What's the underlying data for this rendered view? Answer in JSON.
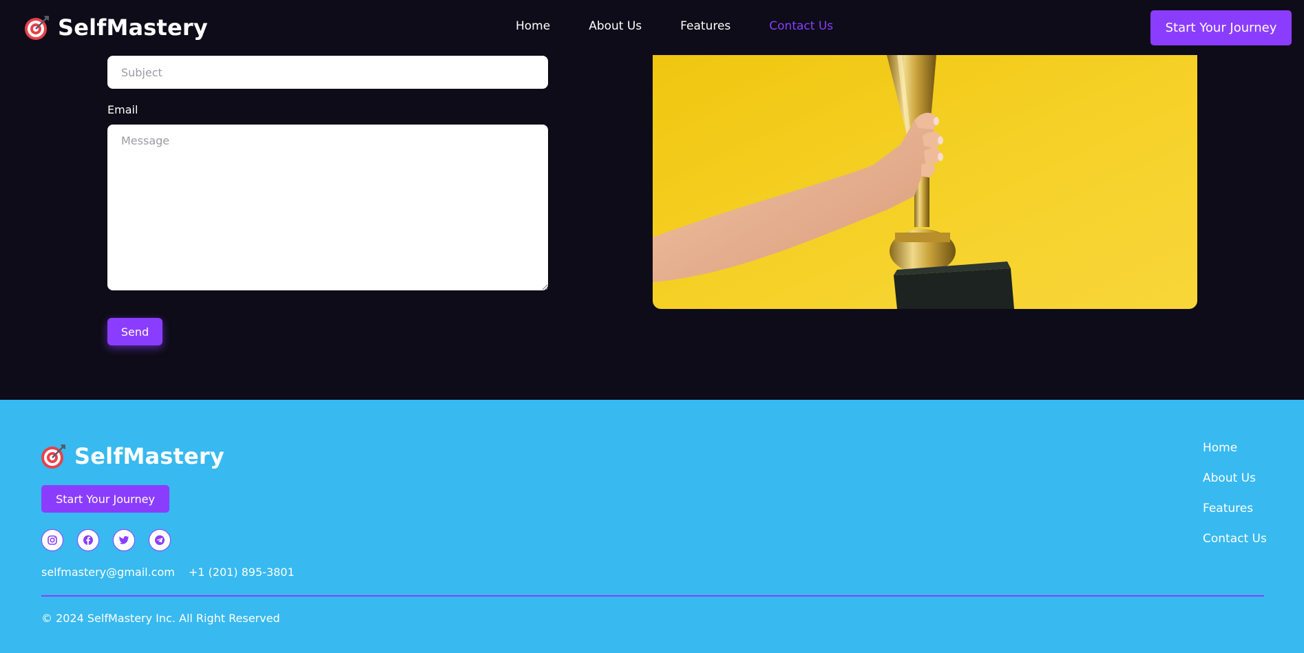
{
  "header": {
    "brand_name": "SelfMastery",
    "nav": [
      {
        "label": "Home",
        "active": false
      },
      {
        "label": "About Us",
        "active": false
      },
      {
        "label": "Features",
        "active": false
      },
      {
        "label": "Contact Us",
        "active": true
      }
    ],
    "cta_label": "Start Your Journey"
  },
  "contact_form": {
    "subject_placeholder": "Subject",
    "subject_value": "",
    "email_label": "Email",
    "message_placeholder": "Message",
    "message_value": "",
    "send_label": "Send",
    "image_icon": "trophy-photo"
  },
  "footer": {
    "brand_name": "SelfMastery",
    "cta_label": "Start Your Journey",
    "socials": [
      "instagram-icon",
      "facebook-icon",
      "twitter-icon",
      "telegram-icon"
    ],
    "email": "selfmastery@gmail.com",
    "phone": "+1 (201) 895-3801",
    "nav": [
      "Home",
      "About Us",
      "Features",
      "Contact Us"
    ],
    "copyright": "© 2024 SelfMastery Inc. All Right Reserved"
  },
  "colors": {
    "accent": "#8b3dff",
    "page_background": "#0e0c18",
    "footer_background": "#38b9f0",
    "image_background": "#f5cf1f"
  }
}
